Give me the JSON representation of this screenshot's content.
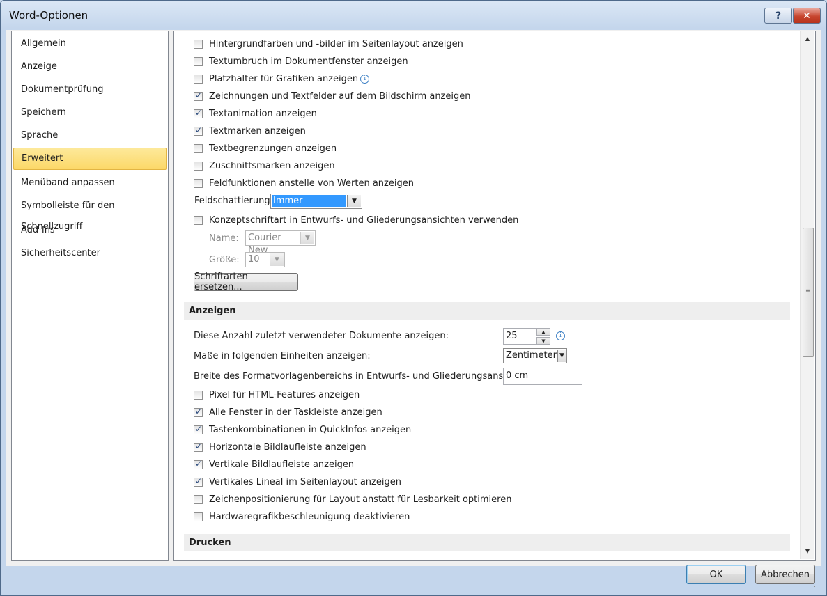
{
  "window": {
    "title": "Word-Optionen",
    "help_label": "?",
    "close_label": "✕"
  },
  "nav": {
    "items": [
      {
        "label": "Allgemein"
      },
      {
        "label": "Anzeige"
      },
      {
        "label": "Dokumentprüfung"
      },
      {
        "label": "Speichern"
      },
      {
        "label": "Sprache"
      },
      {
        "label": "Erweitert",
        "selected": true
      },
      {
        "label": "Menüband anpassen"
      },
      {
        "label": "Symbolleiste für den Schnellzugriff"
      },
      {
        "label": "Add-Ins"
      },
      {
        "label": "Sicherheitscenter"
      }
    ]
  },
  "content": {
    "doc_options": [
      {
        "label": "Hintergrundfarben und -bilder im Seitenlayout anzeigen",
        "checked": false
      },
      {
        "label": "Textumbruch im Dokumentfenster anzeigen",
        "checked": false
      },
      {
        "label": "Platzhalter für Grafiken anzeigen",
        "checked": false
      },
      {
        "label": "Zeichnungen und Textfelder auf dem Bildschirm anzeigen",
        "checked": true
      },
      {
        "label": "Textanimation anzeigen",
        "checked": true
      },
      {
        "label": "Textmarken anzeigen",
        "checked": true
      },
      {
        "label": "Textbegrenzungen anzeigen",
        "checked": false
      },
      {
        "label": "Zuschnittsmarken anzeigen",
        "checked": false
      },
      {
        "label": "Feldfunktionen anstelle von Werten anzeigen",
        "checked": false
      }
    ],
    "field_shading": {
      "label": "Feldschattierung:",
      "value": "Immer"
    },
    "draft_font": {
      "label": "Konzeptschriftart in Entwurfs- und Gliederungsansichten verwenden",
      "checked": false
    },
    "font_name": {
      "label": "Name:",
      "value": "Courier New"
    },
    "font_size": {
      "label": "Größe:",
      "value": "10"
    },
    "replace_fonts_button": "Schriftarten ersetzen...",
    "display_section": {
      "title": "Anzeigen",
      "recent_docs": {
        "label": "Diese Anzahl zuletzt verwendeter Dokumente anzeigen:",
        "value": "25"
      },
      "units": {
        "label": "Maße in folgenden Einheiten anzeigen:",
        "value": "Zentimeter"
      },
      "style_area": {
        "label": "Breite des Formatvorlagenbereichs in Entwurfs- und Gliederungsansichten:",
        "value": "0 cm"
      },
      "options": [
        {
          "label": "Pixel für HTML-Features anzeigen",
          "checked": false
        },
        {
          "label": "Alle Fenster in der Taskleiste anzeigen",
          "checked": true
        },
        {
          "label": "Tastenkombinationen in QuickInfos anzeigen",
          "checked": true
        },
        {
          "label": "Horizontale Bildlaufleiste anzeigen",
          "checked": true
        },
        {
          "label": "Vertikale Bildlaufleiste anzeigen",
          "checked": true
        },
        {
          "label": "Vertikales Lineal im Seitenlayout anzeigen",
          "checked": true
        },
        {
          "label": "Zeichenpositionierung für Layout anstatt für Lesbarkeit optimieren",
          "checked": false
        },
        {
          "label": "Hardwaregrafikbeschleunigung deaktivieren",
          "checked": false
        }
      ]
    },
    "print_section": {
      "title": "Drucken"
    }
  },
  "footer": {
    "ok_label": "OK",
    "cancel_label": "Abbrechen"
  },
  "icons": {
    "info": "info-icon",
    "dropdown": "chevron-down-icon"
  }
}
